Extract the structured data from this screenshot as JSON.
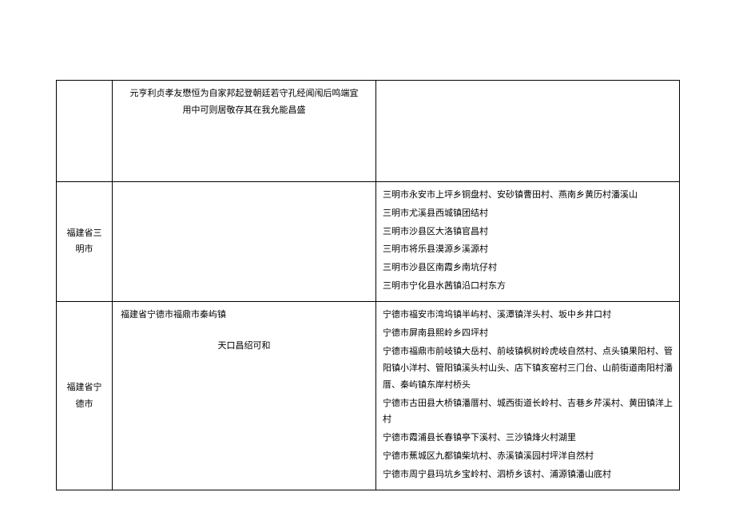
{
  "rows": [
    {
      "region": "",
      "mid_text_1": "元亨利贞孝友懋恒为自家邦起登朝廷若守孔经闻闱后鸣端宜用中可则居敬存其在我允能昌盛",
      "right_lines": []
    },
    {
      "region": "福建省三明市",
      "right_lines": [
        "三明市永安市上坪乡铜盘村、安砂镇曹田村、燕南乡黄历村潘溪山",
        "三明市尤溪县西城镇团结村",
        "三明市沙县区大洛镇官昌村",
        "三明市将乐县漠源乡溪源村",
        "三明市沙县区南霞乡南坑仔村",
        "三明市宁化县水茜镇沿口村东方"
      ]
    },
    {
      "region": "福建省宁德市",
      "mid_heading": "福建省宁德市福鼎市秦屿镇",
      "mid_center": "天口昌绍可和",
      "right_lines": [
        "宁德市福安市湾坞镇半屿村、溪潭镇洋头村、坂中乡井口村",
        "宁德市屏南县熙岭乡四坪村",
        "宁德市福鼎市前岐镇大岳村、前岐镇枫树岭虎岐自然村、点头镇果阳村、管阳镇小洋村、管阳镇溪头村山头、店下镇亥窑村三门台、山前街道南阳村潘厝、秦屿镇东岸村桥头",
        "宁德市古田县大桥镇潘厝村、城西街道长岭村、吉巷乡芹溪村、黄田镇洋上村",
        "宁德市霞浦县长春镇亭下溪村、三沙镇烽火村湖里",
        "宁德市蕉城区九都镇柴坑村、赤溪镇溪园村坪洋自然村",
        "宁德市周宁县玛坑乡宝岭村、泗桥乡该村、浦源镇潘山底村"
      ]
    }
  ]
}
